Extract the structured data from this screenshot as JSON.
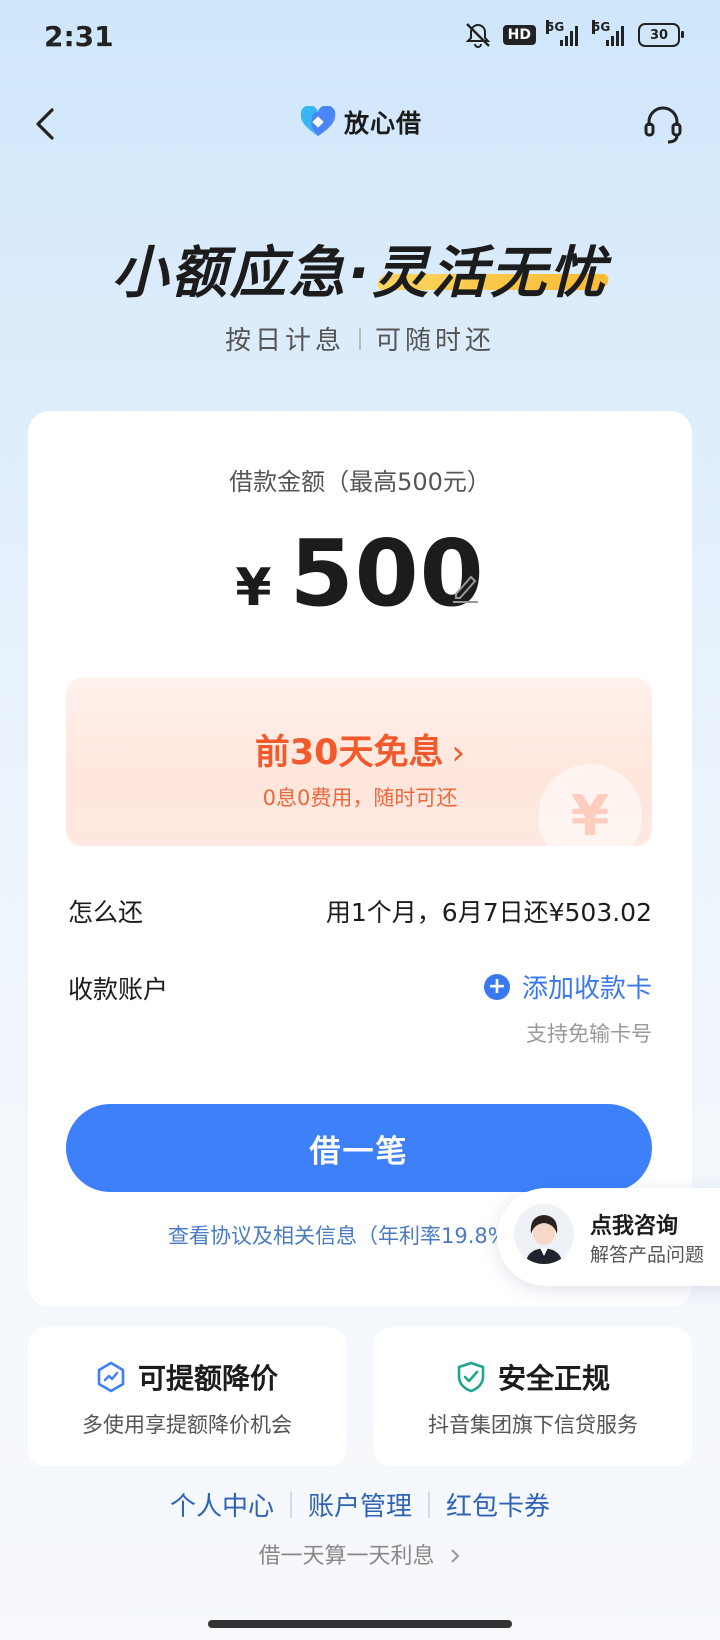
{
  "status_bar": {
    "time": "2:31",
    "hd": "HD",
    "net1": "5G",
    "net2": "5G",
    "battery": "30"
  },
  "header": {
    "brand": "放心借"
  },
  "hero": {
    "title": "小额应急·灵活无忧",
    "tag1": "按日计息",
    "tag2": "可随时还"
  },
  "loan": {
    "amount_label": "借款金额（最高500元）",
    "currency": "¥",
    "amount": "500",
    "promo_title": "前30天免息",
    "promo_arrow": "›",
    "promo_sub": "0息0费用，随时可还",
    "promo_coin": "¥",
    "repay_label": "怎么还",
    "repay_value": "用1个月，6月7日还¥503.02",
    "account_label": "收款账户",
    "add_card": "添加收款卡",
    "add_card_hint": "支持免输卡号",
    "borrow_button": "借一笔",
    "agreement": "查看协议及相关信息（年利率19.8%）"
  },
  "consult": {
    "title": "点我咨询",
    "subtitle": "解答产品问题"
  },
  "features": [
    {
      "title": "可提额降价",
      "desc": "多使用享提额降价机会",
      "icon": "growth-icon"
    },
    {
      "title": "安全正规",
      "desc": "抖音集团旗下信贷服务",
      "icon": "shield-check-icon"
    }
  ],
  "footer": {
    "links": [
      "个人中心",
      "账户管理",
      "红包卡券"
    ],
    "tagline": "借一天算一天利息"
  },
  "colors": {
    "primary": "#3d80fa",
    "promo": "#f25a2c",
    "link": "#2f63b7"
  }
}
